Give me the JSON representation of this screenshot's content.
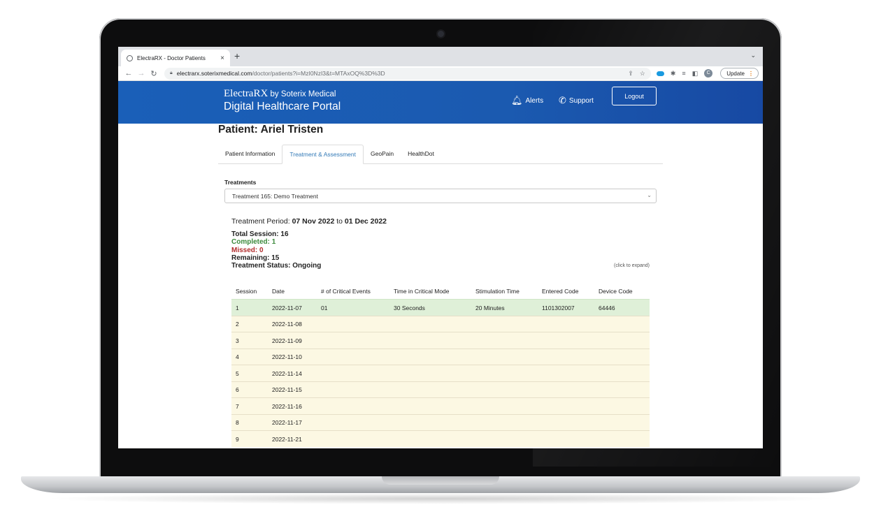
{
  "browser": {
    "tab_title": "ElectraRX - Doctor Patients",
    "tab_close": "×",
    "new_tab": "+",
    "tab_menu": "⌄",
    "url_host": "electrarx.soterixmedical.com",
    "url_path": "/doctor/patients?i=MzI0NzI3&t=MTAxOQ%3D%3D",
    "profile_initial": "C",
    "update_label": "Update"
  },
  "header": {
    "brand_name": "ElectraRX",
    "brand_by": " by Soterix Medical",
    "portal_name": "Digital Healthcare Portal",
    "alerts_label": "Alerts",
    "support_label": "Support",
    "logout_label": "Logout"
  },
  "page": {
    "title": "Patient: Ariel Tristen",
    "tabs": [
      {
        "label": "Patient Information"
      },
      {
        "label": "Treatment & Assessment"
      },
      {
        "label": "GeoPain"
      },
      {
        "label": "HealthDot"
      }
    ],
    "treatments_label": "Treatments",
    "selected_treatment": "Treatment 165: Demo Treatment",
    "period_label": "Treatment Period: ",
    "period_start": "07 Nov 2022",
    "period_to": " to ",
    "period_end": "01 Dec 2022",
    "total_sessions": "Total Session: 16",
    "completed": "Completed: 1",
    "missed": "Missed: 0",
    "remaining": "Remaining: 15",
    "status": "Treatment Status: Ongoing",
    "expand_hint": "(click to expand)"
  },
  "sessions_table": {
    "headers": [
      "Session",
      "Date",
      "# of Critical Events",
      "Time in Critical Mode",
      "Stimulation Time",
      "Entered Code",
      "Device Code"
    ],
    "rows": [
      {
        "session": "1",
        "date": "2022-11-07",
        "critical_events": "01",
        "critical_time": "30 Seconds",
        "stim_time": "20 Minutes",
        "entered_code": "1101302007",
        "device_code": "64446",
        "status": "complete"
      },
      {
        "session": "2",
        "date": "2022-11-08",
        "critical_events": "",
        "critical_time": "",
        "stim_time": "",
        "entered_code": "",
        "device_code": "",
        "status": "pending"
      },
      {
        "session": "3",
        "date": "2022-11-09",
        "critical_events": "",
        "critical_time": "",
        "stim_time": "",
        "entered_code": "",
        "device_code": "",
        "status": "pending"
      },
      {
        "session": "4",
        "date": "2022-11-10",
        "critical_events": "",
        "critical_time": "",
        "stim_time": "",
        "entered_code": "",
        "device_code": "",
        "status": "pending"
      },
      {
        "session": "5",
        "date": "2022-11-14",
        "critical_events": "",
        "critical_time": "",
        "stim_time": "",
        "entered_code": "",
        "device_code": "",
        "status": "pending"
      },
      {
        "session": "6",
        "date": "2022-11-15",
        "critical_events": "",
        "critical_time": "",
        "stim_time": "",
        "entered_code": "",
        "device_code": "",
        "status": "pending"
      },
      {
        "session": "7",
        "date": "2022-11-16",
        "critical_events": "",
        "critical_time": "",
        "stim_time": "",
        "entered_code": "",
        "device_code": "",
        "status": "pending"
      },
      {
        "session": "8",
        "date": "2022-11-17",
        "critical_events": "",
        "critical_time": "",
        "stim_time": "",
        "entered_code": "",
        "device_code": "",
        "status": "pending"
      },
      {
        "session": "9",
        "date": "2022-11-21",
        "critical_events": "",
        "critical_time": "",
        "stim_time": "",
        "entered_code": "",
        "device_code": "",
        "status": "pending"
      }
    ]
  },
  "colors": {
    "header_blue": "#1a5fb8",
    "row_complete": "#dff0d8",
    "row_pending": "#fcf8e3",
    "completed_text": "#3c8a3c",
    "missed_text": "#b22d2d",
    "active_tab": "#337ab7"
  }
}
